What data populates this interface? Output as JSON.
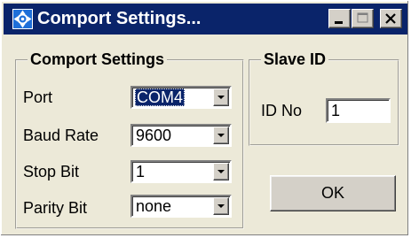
{
  "window": {
    "title": "Comport Settings...",
    "icon": "network-icon",
    "controls": [
      "minimize",
      "maximize",
      "close"
    ]
  },
  "comport_group": {
    "legend": "Comport Settings",
    "fields": [
      {
        "label": "Port",
        "value": "COM4"
      },
      {
        "label": "Baud Rate",
        "value": "9600"
      },
      {
        "label": "Stop Bit",
        "value": "1"
      },
      {
        "label": "Parity Bit",
        "value": "none"
      }
    ]
  },
  "slave_group": {
    "legend": "Slave ID",
    "id_label": "ID No",
    "id_value": "1"
  },
  "ok_label": "OK",
  "colors": {
    "titlebar": "#0a246a",
    "face": "#ece9d8",
    "button_face": "#d4d0c8",
    "selection": "#0a246a"
  }
}
